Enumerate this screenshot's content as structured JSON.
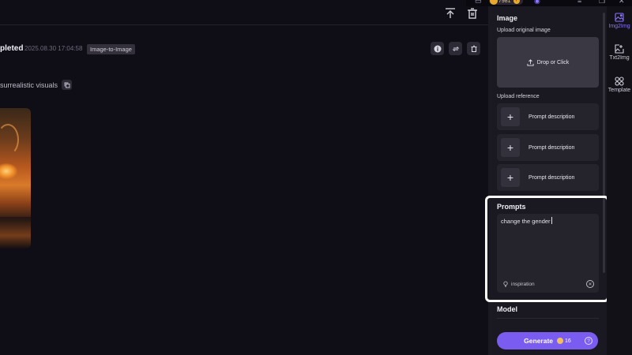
{
  "window": {
    "coin_balance": "7981"
  },
  "job": {
    "status": "pleted",
    "timestamp": "2025.08.30 17:04:58",
    "type_badge": "Image-to-Image",
    "prompt": "surrealistic visuals"
  },
  "panel": {
    "image_title": "Image",
    "upload_original_label": "Upload original image",
    "drop_label": "Drop or Click",
    "upload_reference_label": "Upload reference",
    "references": [
      {
        "label": "Prompt description"
      },
      {
        "label": "Prompt description"
      },
      {
        "label": "Prompt description"
      }
    ],
    "prompts_title": "Prompts",
    "prompt_value": "change the gender",
    "inspiration_label": "inspiration",
    "model_title": "Model",
    "generate_label": "Generate",
    "generate_cost": "16"
  },
  "rail": {
    "items": [
      {
        "label": "Img2Img",
        "icon": "image-icon",
        "active": true
      },
      {
        "label": "Txt2Img",
        "icon": "edit-image-icon",
        "active": false
      },
      {
        "label": "Template",
        "icon": "grid-icon",
        "active": false
      }
    ]
  },
  "colors": {
    "accent": "#7b5cf0",
    "active_rail": "#8a74ff",
    "panel_bg": "#1a1820",
    "main_bg": "#0f0d15"
  }
}
